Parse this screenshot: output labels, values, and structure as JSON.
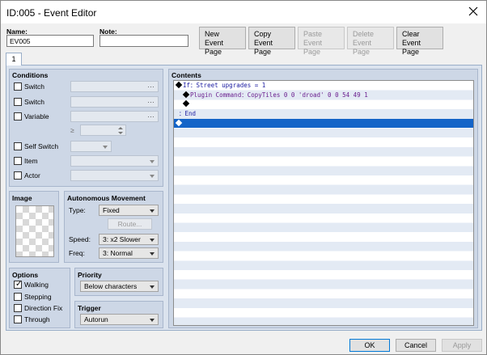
{
  "window": {
    "title": "ID:005 - Event Editor"
  },
  "header": {
    "name_label": "Name:",
    "name_value": "EV005",
    "note_label": "Note:",
    "note_value": "",
    "buttons": [
      {
        "line1": "New",
        "line2": "Event Page",
        "enabled": true
      },
      {
        "line1": "Copy",
        "line2": "Event Page",
        "enabled": true
      },
      {
        "line1": "Paste",
        "line2": "Event Page",
        "enabled": false
      },
      {
        "line1": "Delete",
        "line2": "Event Page",
        "enabled": false
      },
      {
        "line1": "Clear",
        "line2": "Event Page",
        "enabled": true
      }
    ]
  },
  "tabs": [
    {
      "label": "1"
    }
  ],
  "conditions": {
    "title": "Conditions",
    "switch1": "Switch",
    "switch2": "Switch",
    "variable": "Variable",
    "ge": "≥",
    "self_switch": "Self Switch",
    "item": "Item",
    "actor": "Actor"
  },
  "image": {
    "title": "Image"
  },
  "autonomous": {
    "title": "Autonomous Movement",
    "type_label": "Type:",
    "type_value": "Fixed",
    "route_label": "Route...",
    "speed_label": "Speed:",
    "speed_value": "3: x2 Slower",
    "freq_label": "Freq:",
    "freq_value": "3: Normal"
  },
  "options": {
    "title": "Options",
    "walking": "Walking",
    "walking_checked": true,
    "stepping": "Stepping",
    "direction_fix": "Direction Fix",
    "through": "Through",
    "checkmark": "✓"
  },
  "priority": {
    "title": "Priority",
    "value": "Below characters"
  },
  "trigger": {
    "title": "Trigger",
    "value": "Autorun"
  },
  "contents": {
    "title": "Contents",
    "lines": [
      {
        "prefix": "If",
        "sep": "：",
        "text": "Street upgrades = 1"
      },
      {
        "prefix": "Plugin Command",
        "sep": "：",
        "text": "CopyTiles 0 0 'droad' 0 0 54 49 1"
      },
      {
        "prefix": "",
        "sep": "",
        "text": ""
      },
      {
        "prefix": "",
        "sep": "：",
        "text": "End"
      },
      {
        "prefix": "",
        "sep": "",
        "text": ""
      }
    ]
  },
  "footer": {
    "ok": "OK",
    "cancel": "Cancel",
    "apply": "Apply"
  }
}
